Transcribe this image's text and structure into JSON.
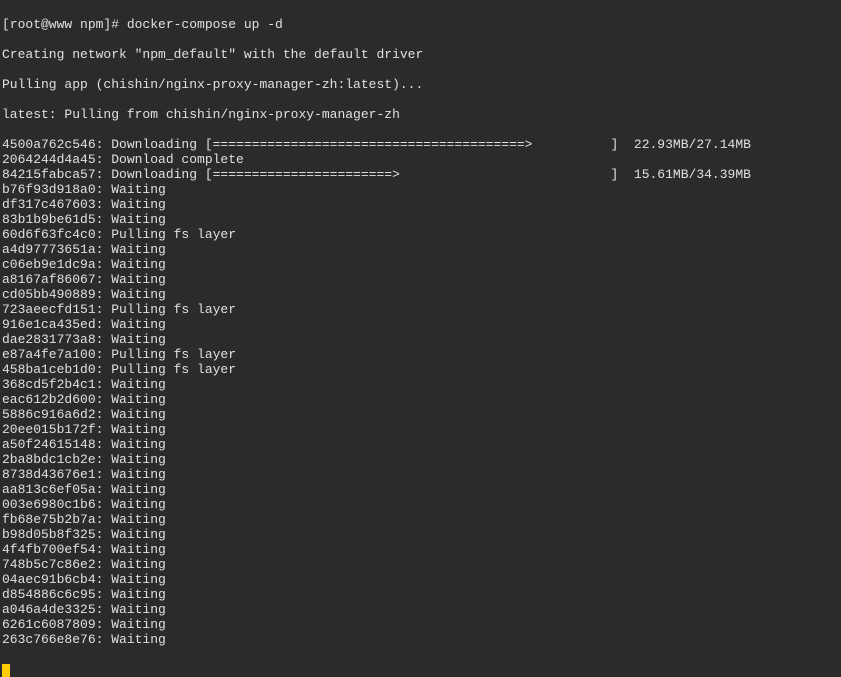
{
  "prompt": "[root@www npm]# docker-compose up -d",
  "creating_network": "Creating network \"npm_default\" with the default driver",
  "pulling_app": "Pulling app (chishin/nginx-proxy-manager-zh:latest)...",
  "latest_pulling": "latest: Pulling from chishin/nginx-proxy-manager-zh",
  "layers": [
    {
      "id": "4500a762c546",
      "status": "Downloading",
      "bar": "[========================================>          ]",
      "progress": "22.93MB/27.14MB"
    },
    {
      "id": "2064244d4a45",
      "status": "Download complete",
      "bar": "",
      "progress": ""
    },
    {
      "id": "84215fabca57",
      "status": "Downloading",
      "bar": "[=======================>                           ]",
      "progress": "15.61MB/34.39MB"
    },
    {
      "id": "b76f93d918a0",
      "status": "Waiting",
      "bar": "",
      "progress": ""
    },
    {
      "id": "df317c467603",
      "status": "Waiting",
      "bar": "",
      "progress": ""
    },
    {
      "id": "83b1b9be61d5",
      "status": "Waiting",
      "bar": "",
      "progress": ""
    },
    {
      "id": "60d6f63fc4c0",
      "status": "Pulling fs layer",
      "bar": "",
      "progress": ""
    },
    {
      "id": "a4d97773651a",
      "status": "Waiting",
      "bar": "",
      "progress": ""
    },
    {
      "id": "c06eb9e1dc9a",
      "status": "Waiting",
      "bar": "",
      "progress": ""
    },
    {
      "id": "a8167af86067",
      "status": "Waiting",
      "bar": "",
      "progress": ""
    },
    {
      "id": "cd05bb490889",
      "status": "Waiting",
      "bar": "",
      "progress": ""
    },
    {
      "id": "723aeecfd151",
      "status": "Pulling fs layer",
      "bar": "",
      "progress": ""
    },
    {
      "id": "916e1ca435ed",
      "status": "Waiting",
      "bar": "",
      "progress": ""
    },
    {
      "id": "dae2831773a8",
      "status": "Waiting",
      "bar": "",
      "progress": ""
    },
    {
      "id": "e87a4fe7a100",
      "status": "Pulling fs layer",
      "bar": "",
      "progress": ""
    },
    {
      "id": "458ba1ceb1d0",
      "status": "Pulling fs layer",
      "bar": "",
      "progress": ""
    },
    {
      "id": "368cd5f2b4c1",
      "status": "Waiting",
      "bar": "",
      "progress": ""
    },
    {
      "id": "eac612b2d600",
      "status": "Waiting",
      "bar": "",
      "progress": ""
    },
    {
      "id": "5886c916a6d2",
      "status": "Waiting",
      "bar": "",
      "progress": ""
    },
    {
      "id": "20ee015b172f",
      "status": "Waiting",
      "bar": "",
      "progress": ""
    },
    {
      "id": "a50f24615148",
      "status": "Waiting",
      "bar": "",
      "progress": ""
    },
    {
      "id": "2ba8bdc1cb2e",
      "status": "Waiting",
      "bar": "",
      "progress": ""
    },
    {
      "id": "8738d43676e1",
      "status": "Waiting",
      "bar": "",
      "progress": ""
    },
    {
      "id": "aa813c6ef05a",
      "status": "Waiting",
      "bar": "",
      "progress": ""
    },
    {
      "id": "003e6980c1b6",
      "status": "Waiting",
      "bar": "",
      "progress": ""
    },
    {
      "id": "fb68e75b2b7a",
      "status": "Waiting",
      "bar": "",
      "progress": ""
    },
    {
      "id": "b98d05b8f325",
      "status": "Waiting",
      "bar": "",
      "progress": ""
    },
    {
      "id": "4f4fb700ef54",
      "status": "Waiting",
      "bar": "",
      "progress": ""
    },
    {
      "id": "748b5c7c86e2",
      "status": "Waiting",
      "bar": "",
      "progress": ""
    },
    {
      "id": "04aec91b6cb4",
      "status": "Waiting",
      "bar": "",
      "progress": ""
    },
    {
      "id": "d854886c6c95",
      "status": "Waiting",
      "bar": "",
      "progress": ""
    },
    {
      "id": "a046a4de3325",
      "status": "Waiting",
      "bar": "",
      "progress": ""
    },
    {
      "id": "6261c6087809",
      "status": "Waiting",
      "bar": "",
      "progress": ""
    },
    {
      "id": "263c766e8e76",
      "status": "Waiting",
      "bar": "",
      "progress": ""
    }
  ]
}
